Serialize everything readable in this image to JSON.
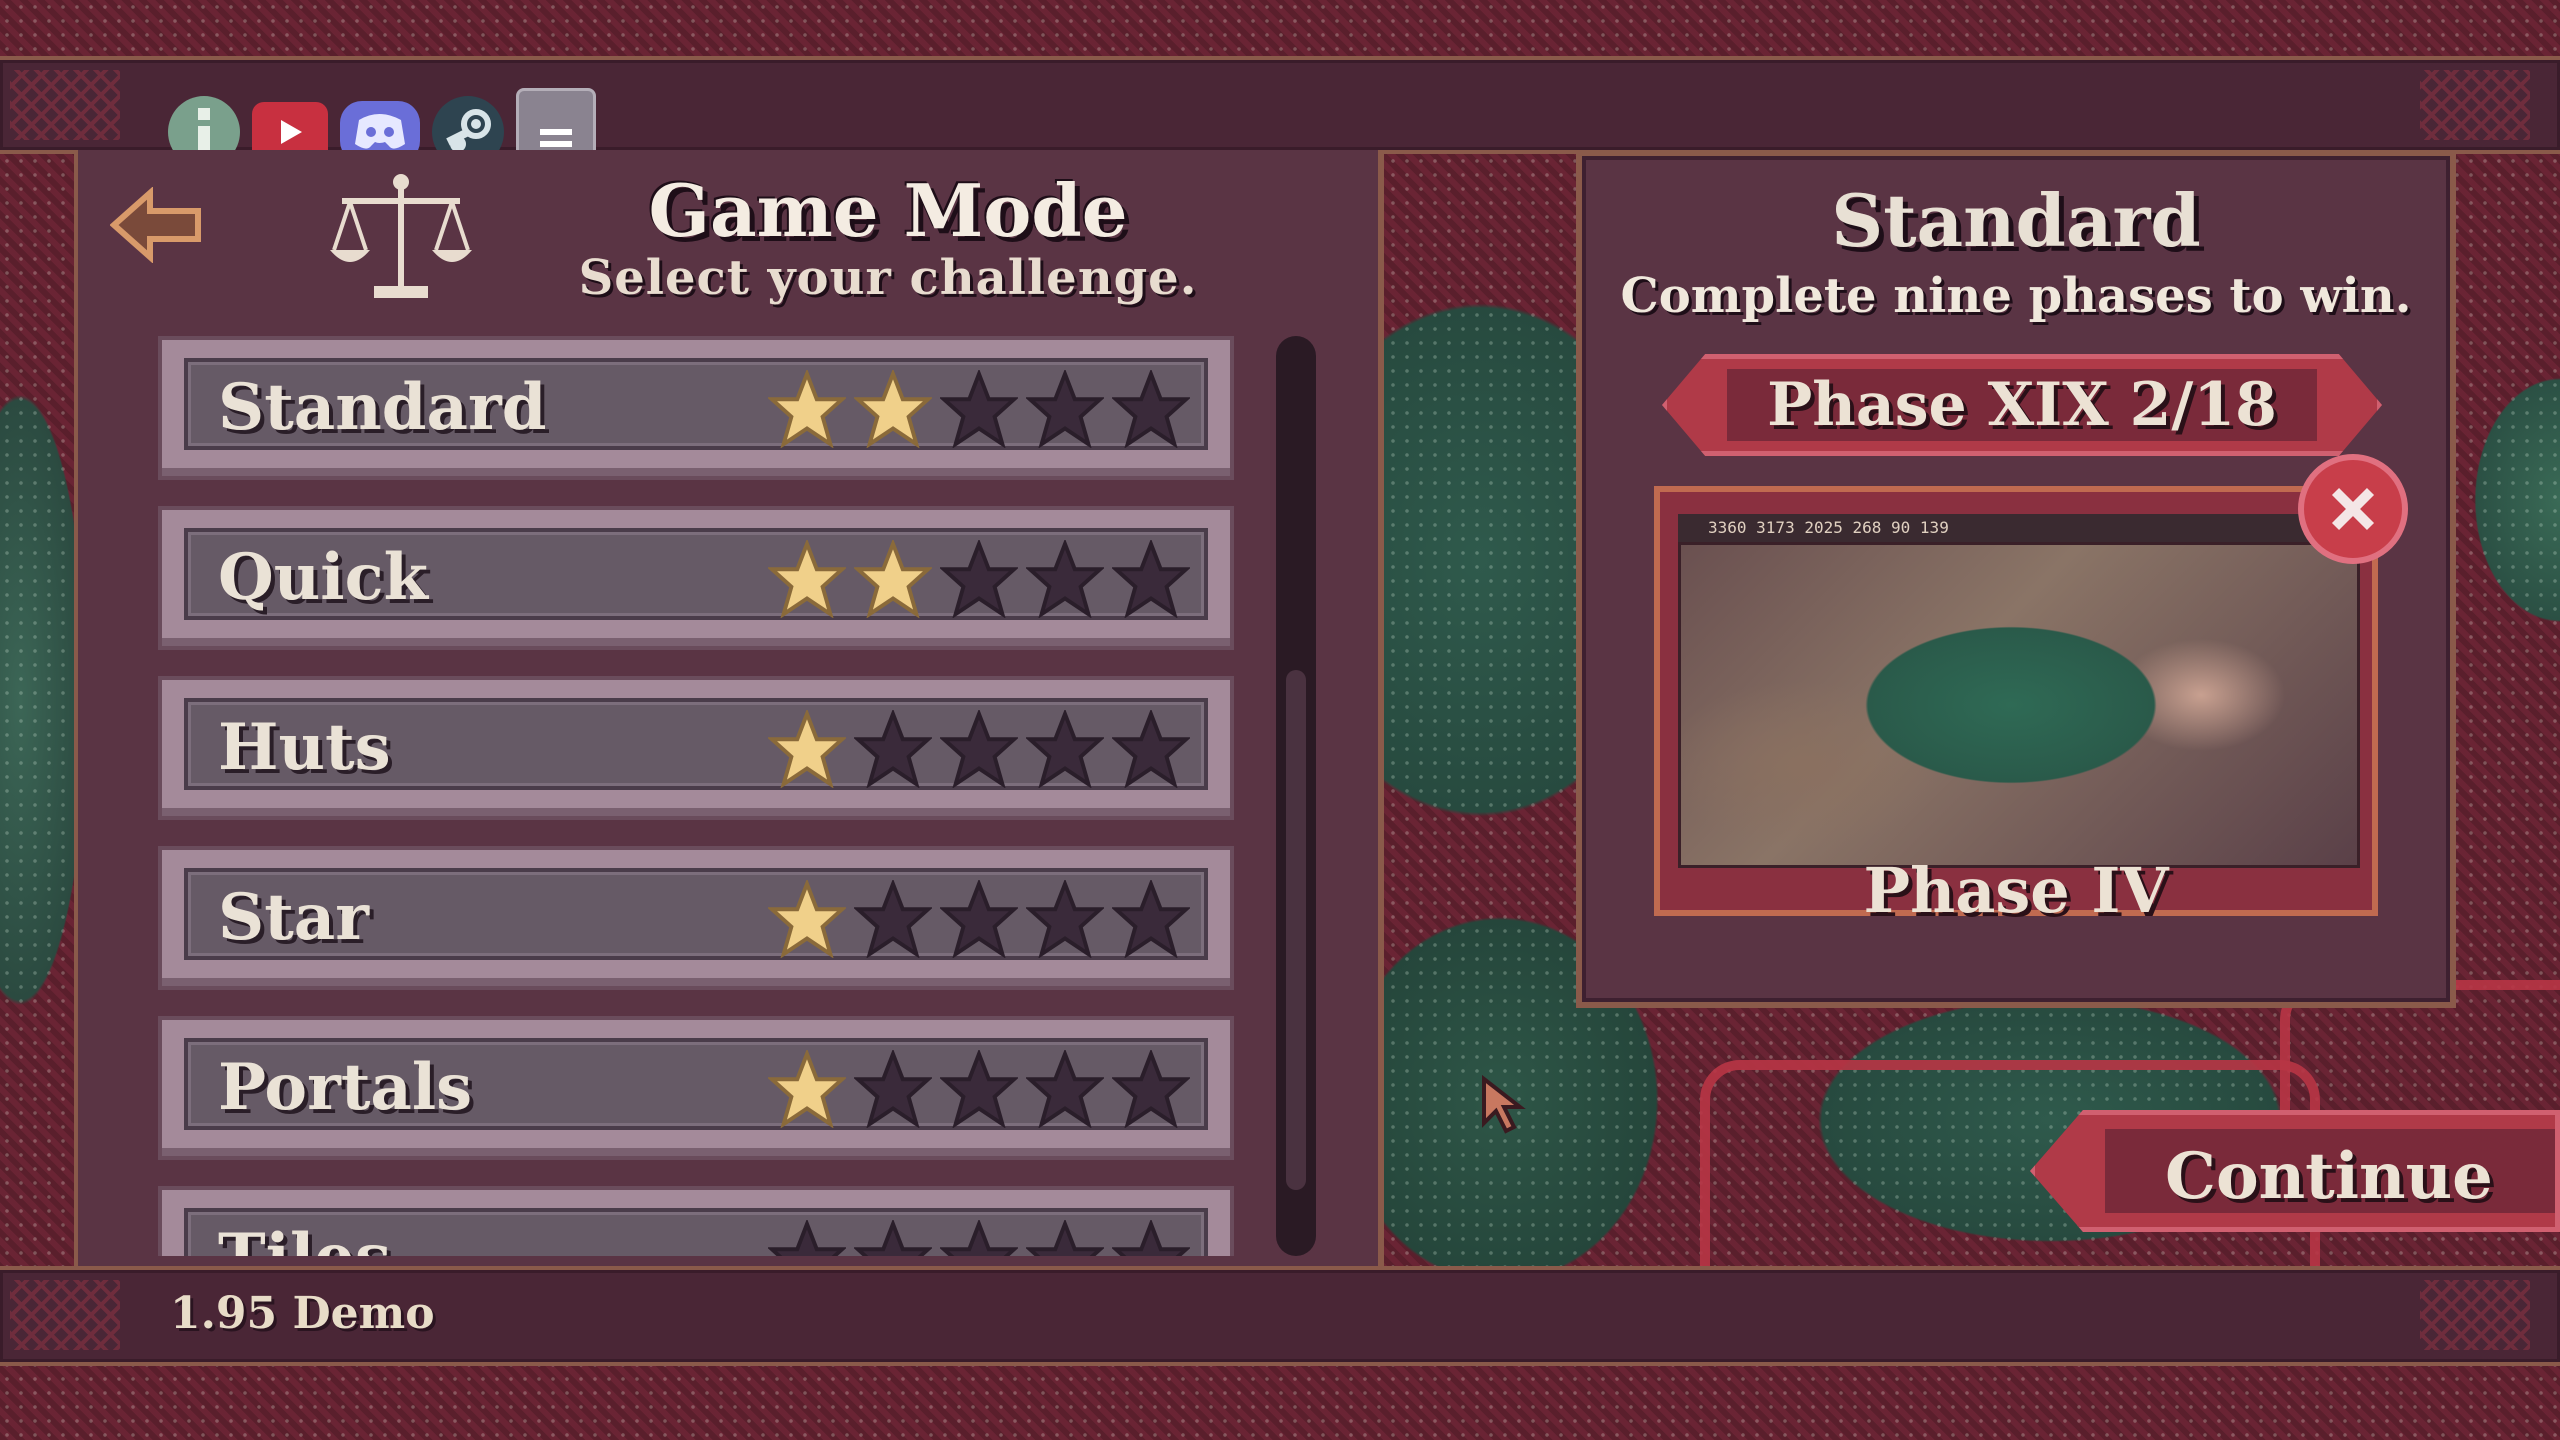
{
  "top_bar": {
    "icons": [
      "info-icon",
      "youtube-icon",
      "discord-icon",
      "steam-icon",
      "menu-icon"
    ]
  },
  "left_panel": {
    "title": "Game Mode",
    "subtitle": "Select your challenge.",
    "modes": [
      {
        "name": "Standard",
        "stars": 2,
        "max_stars": 5
      },
      {
        "name": "Quick",
        "stars": 2,
        "max_stars": 5
      },
      {
        "name": "Huts",
        "stars": 1,
        "max_stars": 5
      },
      {
        "name": "Star",
        "stars": 1,
        "max_stars": 5
      },
      {
        "name": "Portals",
        "stars": 1,
        "max_stars": 5
      },
      {
        "name": "Tiles",
        "stars": 0,
        "max_stars": 5
      }
    ]
  },
  "right_panel": {
    "title": "Standard",
    "description": "Complete nine phases to win.",
    "phase_banner": "Phase XIX  2/18",
    "preview_hud": "3360  3173  2025  268  90  139",
    "preview_label": "Phase IV"
  },
  "continue_label": "Continue",
  "version": "1.95 Demo",
  "colors": {
    "star_filled": "#f0d08a",
    "star_empty": "#3a2a3a",
    "banner_red": "#b03a48",
    "panel_bg": "#5a3444"
  }
}
